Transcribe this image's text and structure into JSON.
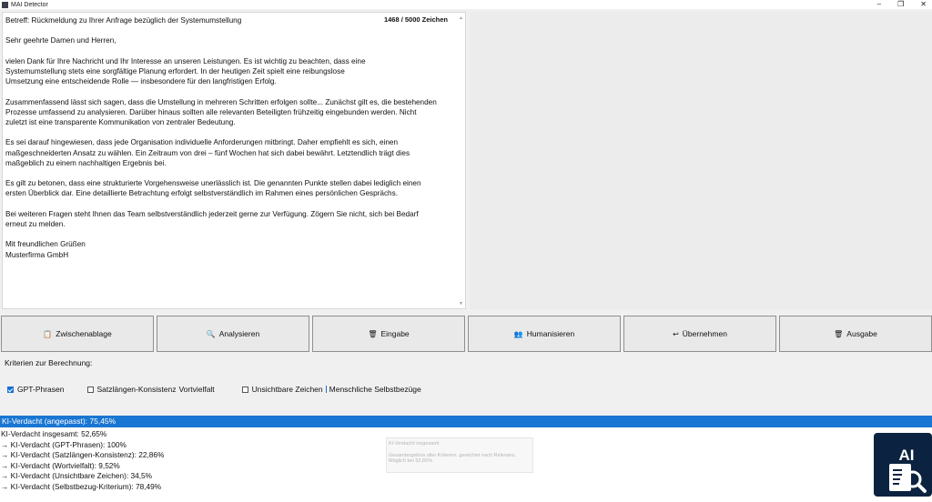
{
  "window": {
    "title": "MAI Detector",
    "icon_letter": "",
    "controls": {
      "minimize": "–",
      "restore": "❐",
      "close": "✕"
    }
  },
  "editor": {
    "counter": "1468 / 5000 Zeichen",
    "text": "Betreff: Rückmeldung zu Ihrer Anfrage bezüglich der Systemumstellung\n\nSehr geehrte Damen und Herren,\n\nvielen Dank für Ihre Nachricht und Ihr Interesse an unseren Leistungen. Es ist wichtig zu beachten, dass eine\nSystemumstellung stets eine sorgfältige Planung erfordert. In der heutigen Zeit spielt eine reibungslose\nUmsetzung eine entscheidende Rolle — insbesondere für den langfristigen Erfolg.\n\nZusammenfassend lässt sich sagen, dass die Umstellung in mehreren Schritten erfolgen sollte... Zunächst gilt es, die bestehenden\nProzesse umfassend zu analysieren. Darüber hinaus sollten alle relevanten Beteiligten frühzeitig eingebunden werden. Nicht\nzuletzt ist eine transparente Kommunikation von zentraler Bedeutung.\n\nEs sei darauf hingewiesen, dass jede Organisation individuelle Anforderungen mitbringt. Daher empfiehlt es sich, einen\nmaßgeschneiderten Ansatz zu wählen. Ein Zeitraum von drei – fünf Wochen hat sich dabei bewährt. Letztendlich trägt dies\nmaßgeblich zu einem nachhaltigen Ergebnis bei.\n\nEs gilt zu betonen, dass eine strukturierte Vorgehensweise unerlässlich ist. Die genannten Punkte stellen dabei lediglich einen\nersten Überblick dar. Eine detaillierte Betrachtung erfolgt selbstverständlich im Rahmen eines persönlichen Gesprächs.\n\nBei weiteren Fragen steht Ihnen das Team selbstverständlich jederzeit gerne zur Verfügung. Zögern Sie nicht, sich bei Bedarf\nerneut zu melden.\n\nMit freundlichen Grüßen\nMusterfirma GmbH"
  },
  "buttons": [
    {
      "icon": "📋",
      "icon_name": "clipboard-icon",
      "label": "Zwischenablage"
    },
    {
      "icon": "🔍",
      "icon_name": "magnifier-icon",
      "label": "Analysieren"
    },
    {
      "icon": "🗑",
      "icon_name": "trash-icon",
      "label": "Eingabe"
    },
    {
      "icon": "👥",
      "icon_name": "people-icon",
      "label": "Humanisieren"
    },
    {
      "icon": "↩",
      "icon_name": "return-arrow-icon",
      "label": "Übernehmen"
    },
    {
      "icon": "🗑",
      "icon_name": "trash-icon",
      "label": "Ausgabe"
    }
  ],
  "criteria": {
    "label": "Kriterien zur Berechnung:",
    "items": [
      {
        "label": "GPT-Phrasen",
        "checked": true
      },
      {
        "label": "Satzlängen-Konsistenz",
        "checked": false
      },
      {
        "label": "Vortvielfalt",
        "checked": false
      },
      {
        "label": "Unsichtbare Zeichen",
        "checked": false
      },
      {
        "label": "Menschliche Selbstbezüge",
        "checked": false
      }
    ]
  },
  "banner": {
    "text": "KI-Verdacht (angepasst): 75,45%",
    "color": "#1976d2"
  },
  "results": [
    "KI-Verdacht insgesamt: 52,65%",
    "→ KI-Verdacht (GPT-Phrasen): 100%",
    "→ KI-Verdacht (Satzlängen-Konsistenz): 22,86%",
    "→ KI-Verdacht (Wortvielfalt): 9,52%",
    "→ KI-Verdacht (Unsichtbare Zeichen): 34,5%",
    "→ KI-Verdacht (Selbstbezug-Kriterium): 78,49%"
  ],
  "tooltip": {
    "title": "KI-Verdacht insgesamt",
    "line1": "Gesamtergebnis aller Kriterien, gewichtet nach Relevanz.",
    "line2": "Möglich bei 52,65%"
  },
  "logo": {
    "text": "AI",
    "icon_name": "ai-document-search-icon"
  }
}
